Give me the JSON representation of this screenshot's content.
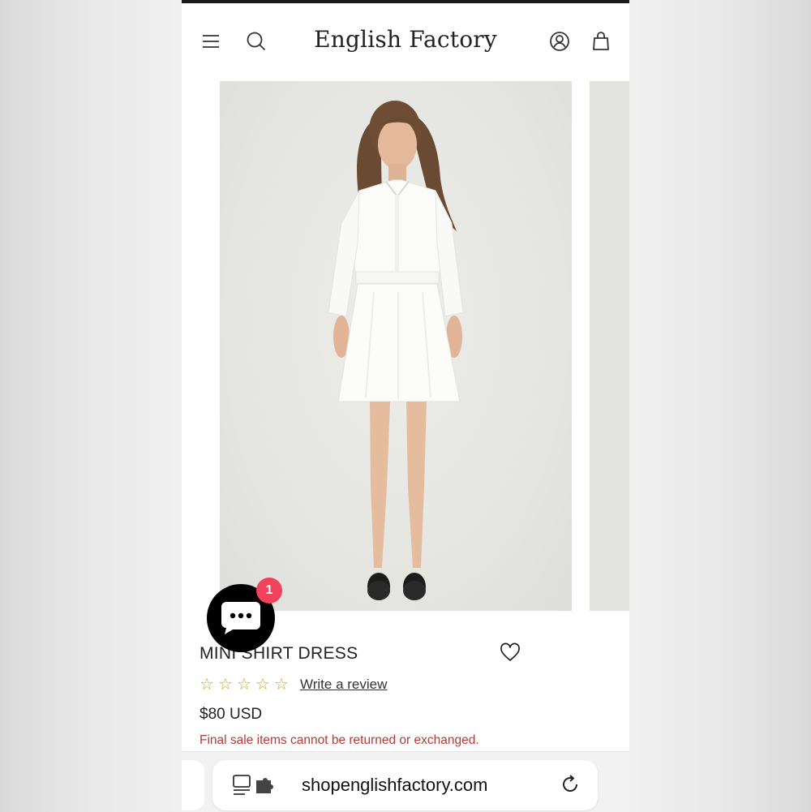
{
  "header": {
    "logo": "English Factory",
    "icons": [
      "hamburger-menu-icon",
      "search-icon",
      "account-icon",
      "shopping-bag-icon"
    ]
  },
  "product": {
    "title": "MINI SHIRT DRESS",
    "rating_stars": 0,
    "rating_max": 5,
    "review_link": "Write a review",
    "price": "$80 USD",
    "final_sale_note": "Final sale items cannot be returned or exchanged."
  },
  "chat": {
    "badge_count": "1"
  },
  "browser": {
    "url": "shopenglishfactory.com"
  },
  "colors": {
    "star": "#d8a21a",
    "final_sale_text": "#b43b36",
    "chat_badge": "#f0415d"
  }
}
